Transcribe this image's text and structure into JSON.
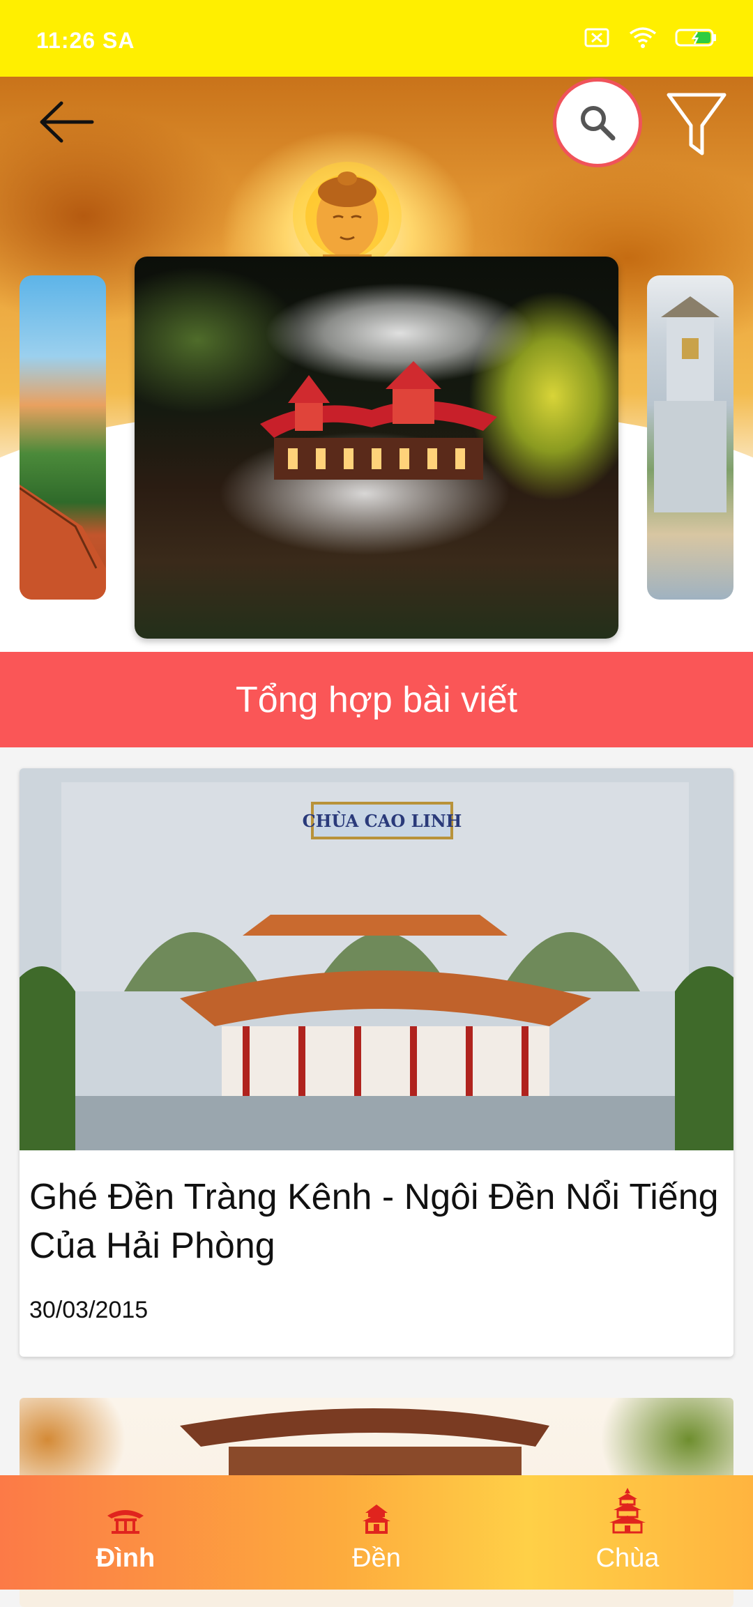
{
  "status_bar": {
    "time": "11:26 SA",
    "icons": [
      "sim-x-icon",
      "wifi-icon",
      "battery-charging-icon"
    ]
  },
  "header": {
    "back_icon": "arrow-left-icon",
    "search_icon": "search-icon",
    "filter_icon": "funnel-icon"
  },
  "carousel": {
    "images": [
      "temple-aerial-view",
      "temple-night-clouds",
      "temple-white-gate"
    ]
  },
  "section": {
    "title": "Tổng hợp bài viết"
  },
  "articles": [
    {
      "image_sign": "CHÙA CAO LINH",
      "title": "Ghé Đền Tràng Kênh - Ngôi Đền Nổi Tiếng Của Hải Phòng",
      "date": "30/03/2015"
    },
    {
      "image_sign": "",
      "title": "",
      "date": ""
    }
  ],
  "bottom_nav": {
    "items": [
      {
        "label": "Đình",
        "icon": "communal-house-icon",
        "active": true
      },
      {
        "label": "Đền",
        "icon": "temple-icon",
        "active": false
      },
      {
        "label": "Chùa",
        "icon": "pagoda-icon",
        "active": false
      }
    ],
    "icon_color": "#e0241e"
  },
  "colors": {
    "status_bar": "#ffef00",
    "section_header": "#fa5657",
    "search_ring": "#f0535a"
  }
}
